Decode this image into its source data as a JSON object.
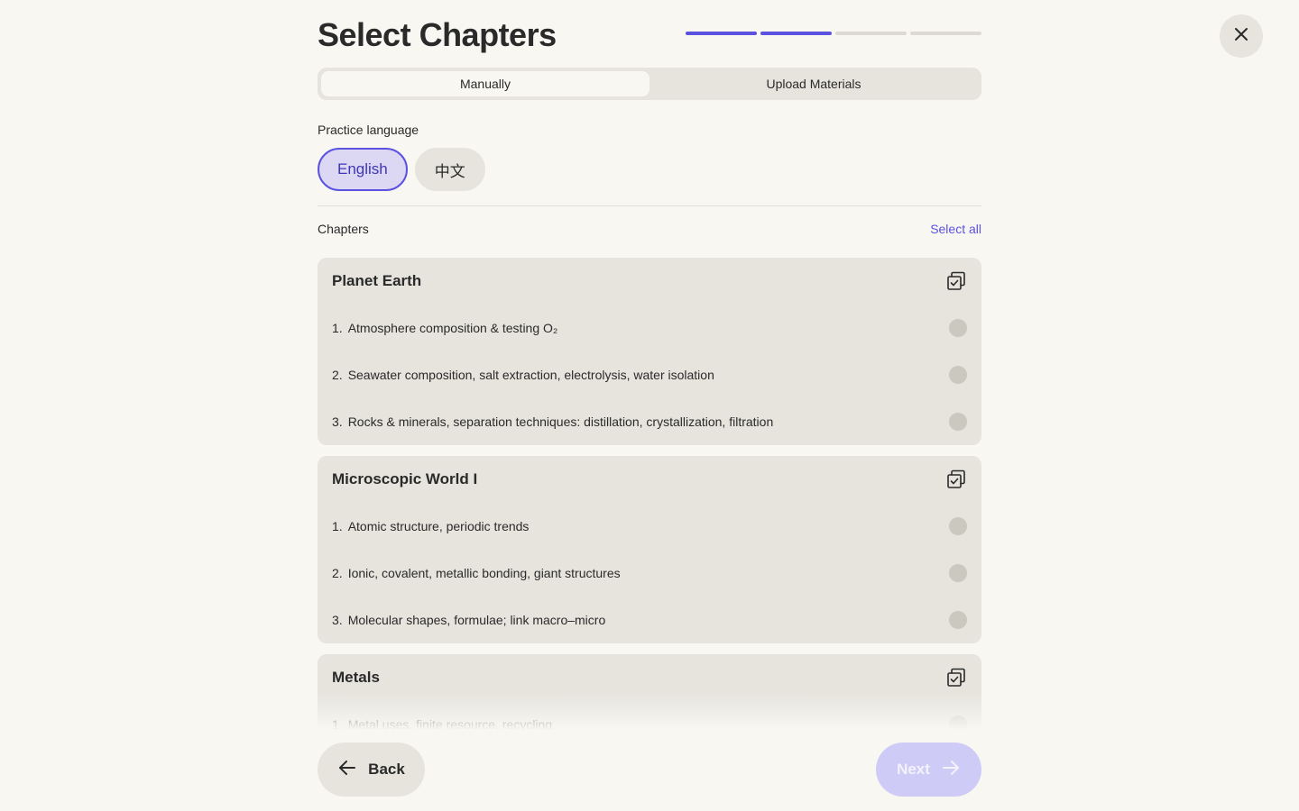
{
  "header": {
    "title": "Select Chapters",
    "progress": {
      "total_steps": 4,
      "completed_steps": 2
    },
    "close_icon": "close-icon"
  },
  "tabs": [
    {
      "label": "Manually",
      "selected": true
    },
    {
      "label": "Upload Materials",
      "selected": false
    }
  ],
  "language": {
    "label": "Practice language",
    "options": [
      {
        "label": "English",
        "selected": true
      },
      {
        "label": "中文",
        "selected": false
      }
    ]
  },
  "chapters": {
    "label": "Chapters",
    "select_all": "Select all",
    "groups": [
      {
        "title": "Planet Earth",
        "items": [
          {
            "num": "1.",
            "text": "Atmosphere composition & testing O₂"
          },
          {
            "num": "2.",
            "text": "Seawater composition, salt extraction, electrolysis, water isolation"
          },
          {
            "num": "3.",
            "text": "Rocks & minerals, separation techniques: distillation, crystallization, filtration"
          }
        ]
      },
      {
        "title": "Microscopic World I",
        "items": [
          {
            "num": "1.",
            "text": "Atomic structure, periodic trends"
          },
          {
            "num": "2.",
            "text": "Ionic, covalent, metallic bonding, giant structures"
          },
          {
            "num": "3.",
            "text": "Molecular shapes, formulae; link macro–micro"
          }
        ]
      },
      {
        "title": "Metals",
        "items": [
          {
            "num": "1.",
            "text": "Metal uses, finite resource, recycling"
          }
        ]
      }
    ]
  },
  "footer": {
    "back_label": "Back",
    "next_label": "Next"
  },
  "colors": {
    "accent": "#5b52e0",
    "background": "#f8f7f2",
    "card": "#e6e4dd",
    "next_disabled": "#cfcbf7"
  }
}
